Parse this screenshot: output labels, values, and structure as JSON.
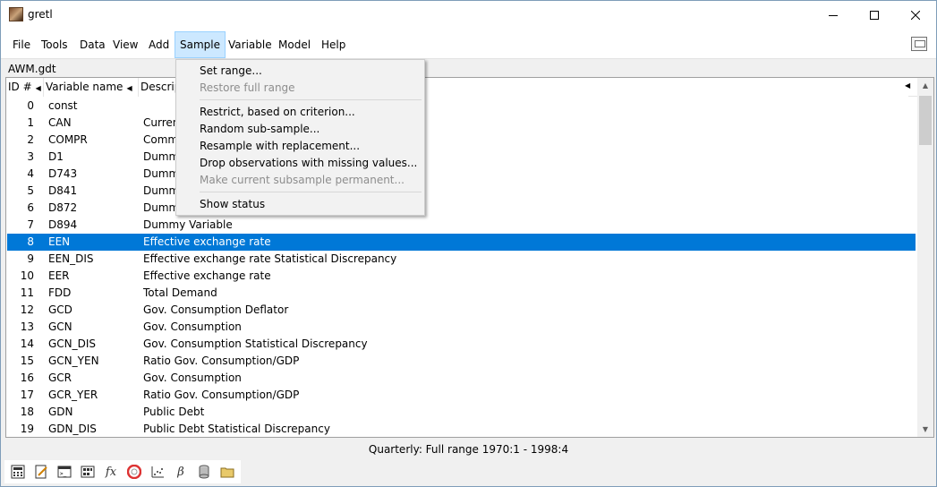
{
  "window": {
    "title": "gretl"
  },
  "menubar": {
    "items": [
      {
        "label": "File",
        "active": false
      },
      {
        "label": "Tools",
        "active": false
      },
      {
        "label": "Data",
        "active": false
      },
      {
        "label": "View",
        "active": false
      },
      {
        "label": "Add",
        "active": false
      },
      {
        "label": "Sample",
        "active": true
      },
      {
        "label": "Variable",
        "active": false
      },
      {
        "label": "Model",
        "active": false
      },
      {
        "label": "Help",
        "active": false
      }
    ]
  },
  "file_label": "AWM.gdt",
  "list": {
    "headers": {
      "id": "ID #",
      "name": "Variable name",
      "desc": "Descrip"
    },
    "selected_index": 8,
    "rows": [
      {
        "id": "0",
        "name": "const",
        "desc": ""
      },
      {
        "id": "1",
        "name": "CAN",
        "desc": "Curren"
      },
      {
        "id": "2",
        "name": "COMPR",
        "desc": "Comm"
      },
      {
        "id": "3",
        "name": "D1",
        "desc": "Dumm"
      },
      {
        "id": "4",
        "name": "D743",
        "desc": "Dumm"
      },
      {
        "id": "5",
        "name": "D841",
        "desc": "Dumm"
      },
      {
        "id": "6",
        "name": "D872",
        "desc": "Dumm"
      },
      {
        "id": "7",
        "name": "D894",
        "desc": "Dummy Variable"
      },
      {
        "id": "8",
        "name": "EEN",
        "desc": "Effective exchange rate"
      },
      {
        "id": "9",
        "name": "EEN_DIS",
        "desc": "Effective exchange rate Statistical Discrepancy"
      },
      {
        "id": "10",
        "name": "EER",
        "desc": "Effective exchange rate"
      },
      {
        "id": "11",
        "name": "FDD",
        "desc": "Total Demand"
      },
      {
        "id": "12",
        "name": "GCD",
        "desc": "Gov. Consumption Deflator"
      },
      {
        "id": "13",
        "name": "GCN",
        "desc": "Gov. Consumption"
      },
      {
        "id": "14",
        "name": "GCN_DIS",
        "desc": "Gov. Consumption Statistical Discrepancy"
      },
      {
        "id": "15",
        "name": "GCN_YEN",
        "desc": "Ratio Gov. Consumption/GDP"
      },
      {
        "id": "16",
        "name": "GCR",
        "desc": "Gov. Consumption"
      },
      {
        "id": "17",
        "name": "GCR_YER",
        "desc": "Ratio Gov. Consumption/GDP"
      },
      {
        "id": "18",
        "name": "GDN",
        "desc": "Public Debt"
      },
      {
        "id": "19",
        "name": "GDN_DIS",
        "desc": "Public Debt Statistical Discrepancy"
      }
    ]
  },
  "sample_menu": {
    "items": [
      {
        "label": "Set range...",
        "disabled": false
      },
      {
        "label": "Restore full range",
        "disabled": true
      },
      {
        "label": "Restrict, based on criterion...",
        "disabled": false
      },
      {
        "label": "Random sub-sample...",
        "disabled": false
      },
      {
        "label": "Resample with replacement...",
        "disabled": false
      },
      {
        "label": "Drop observations with missing values...",
        "disabled": false
      },
      {
        "label": "Make current subsample permanent...",
        "disabled": true
      },
      {
        "label": "Show status",
        "disabled": false
      }
    ]
  },
  "status": "Quarterly: Full range 1970:1 - 1998:4",
  "toolbar": {
    "icons": [
      "calculator-icon",
      "edit-icon",
      "terminal-icon",
      "session-icon",
      "function-icon",
      "help-icon",
      "plot-icon",
      "beta-icon",
      "database-icon",
      "folder-icon"
    ],
    "fx": "fx",
    "beta": "β"
  },
  "colors": {
    "selection": "#0078d7",
    "menu_active": "#cce8ff"
  }
}
